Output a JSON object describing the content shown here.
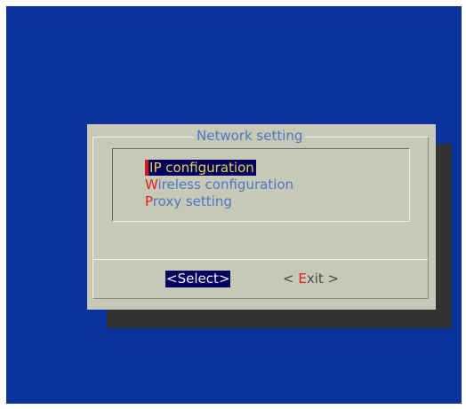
{
  "dialog": {
    "title": "Network setting"
  },
  "menu": {
    "items": [
      {
        "hotkey": "I",
        "rest": "P configuration",
        "selected": true
      },
      {
        "hotkey": "W",
        "rest": "ireless configuration",
        "selected": false
      },
      {
        "hotkey": "P",
        "rest": "roxy setting",
        "selected": false
      }
    ]
  },
  "buttons": {
    "select": "<Select>",
    "exit_prefix": "< ",
    "exit_hotkey": "E",
    "exit_suffix": "xit >"
  },
  "colors": {
    "screen_background": "#0a33a0",
    "dialog_background": "#c8c8b7",
    "shadow": "#323232",
    "title_text": "#4a78c8",
    "hotkey": "#e02020",
    "selection_background": "#000060",
    "selection_text": "#f0d24a"
  }
}
